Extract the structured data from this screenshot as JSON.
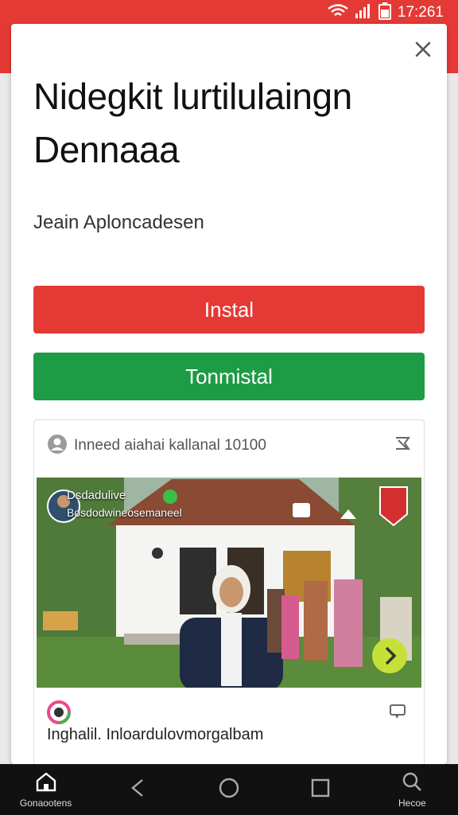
{
  "status_bar": {
    "time": "17:261",
    "icons": [
      "wifi-icon",
      "signal-icon",
      "battery-icon"
    ],
    "color": "#e53935"
  },
  "dialog": {
    "title_line1": "Nidegkit lurtilulaingn",
    "title_line2": "Dennaaa",
    "subtitle": "Jeain Aploncadesen",
    "install_label": "Instal",
    "uninstall_label": "Tonmistal",
    "install_color": "#e53935",
    "uninstall_color": "#1e9b45"
  },
  "card": {
    "header_text": "Inneed aiahai kallanal 10100",
    "overlay_channel": "Dsdadulive",
    "overlay_subtitle": "Bosdodwineosemaneel",
    "footer_text": "Inghalil. Inloardulovmorgalbam"
  },
  "nav_bar": {
    "home_label": "Gonaootens",
    "search_label": "Hecoe"
  }
}
